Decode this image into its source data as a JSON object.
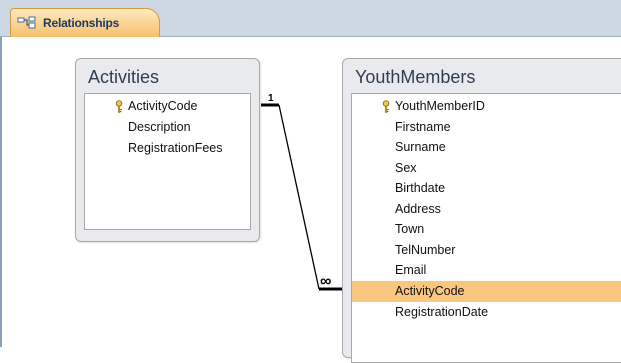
{
  "tab": {
    "label": "Relationships",
    "icon": "relationships-icon"
  },
  "tables": {
    "activities": {
      "title": "Activities",
      "fields": [
        {
          "name": "ActivityCode",
          "primary_key": true
        },
        {
          "name": "Description",
          "primary_key": false
        },
        {
          "name": "RegistrationFees",
          "primary_key": false
        }
      ]
    },
    "youthmembers": {
      "title": "YouthMembers",
      "fields": [
        {
          "name": "YouthMemberID",
          "primary_key": true
        },
        {
          "name": "Firstname",
          "primary_key": false
        },
        {
          "name": "Surname",
          "primary_key": false
        },
        {
          "name": "Sex",
          "primary_key": false
        },
        {
          "name": "Birthdate",
          "primary_key": false
        },
        {
          "name": "Address",
          "primary_key": false
        },
        {
          "name": "Town",
          "primary_key": false
        },
        {
          "name": "TelNumber",
          "primary_key": false
        },
        {
          "name": "Email",
          "primary_key": false
        },
        {
          "name": "ActivityCode",
          "primary_key": false,
          "selected": true
        },
        {
          "name": "RegistrationDate",
          "primary_key": false
        }
      ]
    }
  },
  "relationship": {
    "one_label": "1",
    "many_label": "∞"
  },
  "colors": {
    "selected_field": "#fbc77f",
    "tab": "#f6c06a",
    "line": "#000000"
  }
}
